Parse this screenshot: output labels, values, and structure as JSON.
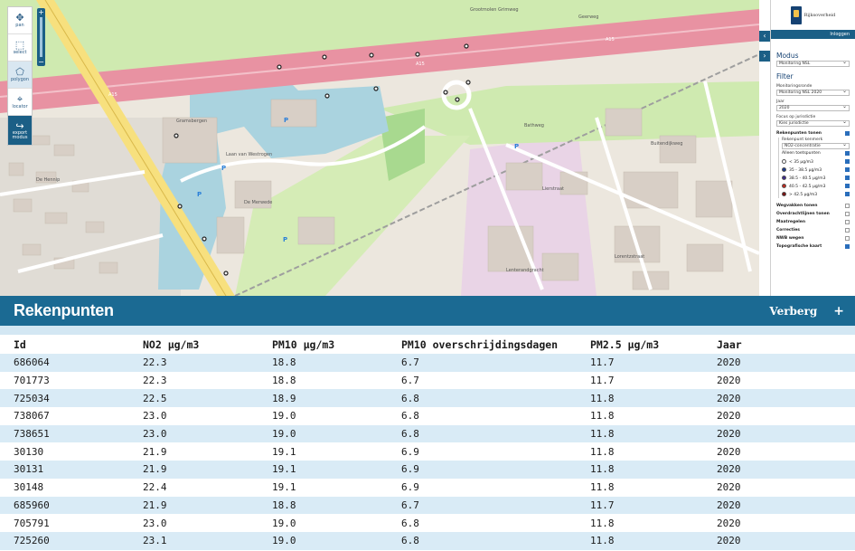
{
  "toolbar": {
    "pan": "pan",
    "select": "select",
    "polygon": "polygon",
    "locator": "locator",
    "export": "export\nmodus"
  },
  "map_labels": {
    "road_a15_1": "A15",
    "road_a15_2": "A15",
    "road_a15_3": "A15",
    "street_1": "Laan van Westrogen",
    "street_2": "De Hennip",
    "street_3": "Bathweg",
    "street_4": "Lierstraat",
    "area_1": "Lorentzstraat",
    "street_5": "Grootmolen Grimweg",
    "street_6": "Geerweg",
    "park_1": "Gramsbergen",
    "street_7": "De Merwede",
    "street_8": "Lenterandgracht",
    "street_9": "Buitendijkweg"
  },
  "panel": {
    "logo_text": "Rijksoverheid",
    "login": "Inloggen",
    "modus_title": "Modus",
    "modus_value": "Monitoring NSL",
    "filter_title": "Filter",
    "ronde_label": "Monitoringsronde",
    "ronde_value": "Monitoring NSL 2020",
    "jaar_label": "Jaar",
    "jaar_value": "2020",
    "focus_label": "Focus op jurisdictie",
    "focus_value": "Kies jurisdictie",
    "rekenpunten_toggle": "Rekenpunten tonen",
    "kenmerk_label": "Rekenpunt kenmerk",
    "kenmerk_value": "NO2-concentratie",
    "alleen": "Alleen toetspunten",
    "legend": [
      {
        "label": "< 35 µg/m3",
        "color": "#ffffff"
      },
      {
        "label": "35 - 38.5 µg/m3",
        "color": "#1c3b8f"
      },
      {
        "label": "38.5 - 40.5 µg/m3",
        "color": "#3c2a8a"
      },
      {
        "label": "40.5 - 42.5 µg/m3",
        "color": "#c0281e"
      },
      {
        "label": "> 42.5 µg/m3",
        "color": "#7a1010"
      }
    ],
    "layers": [
      {
        "label": "Wegvakken tonen",
        "on": false
      },
      {
        "label": "Overdrachtlijnen tonen",
        "on": false
      },
      {
        "label": "Maatregelen",
        "on": false
      },
      {
        "label": "Correcties",
        "on": false
      },
      {
        "label": "NWB wegen",
        "on": false
      },
      {
        "label": "Topografische kaart",
        "on": true
      }
    ]
  },
  "section": {
    "title": "Rekenpunten",
    "hide_button": "Verberg",
    "plus_button": "+"
  },
  "table": {
    "headers": [
      "Id",
      "NO2 µg/m3",
      "PM10 µg/m3",
      "PM10 overschrijdingsdagen",
      "PM2.5 µg/m3",
      "Jaar"
    ],
    "rows": [
      [
        "686064",
        "22.3",
        "18.8",
        "6.7",
        "11.7",
        "2020"
      ],
      [
        "701773",
        "22.3",
        "18.8",
        "6.7",
        "11.7",
        "2020"
      ],
      [
        "725034",
        "22.5",
        "18.9",
        "6.8",
        "11.8",
        "2020"
      ],
      [
        "738067",
        "23.0",
        "19.0",
        "6.8",
        "11.8",
        "2020"
      ],
      [
        "738651",
        "23.0",
        "19.0",
        "6.8",
        "11.8",
        "2020"
      ],
      [
        "30130",
        "21.9",
        "19.1",
        "6.9",
        "11.8",
        "2020"
      ],
      [
        "30131",
        "21.9",
        "19.1",
        "6.9",
        "11.8",
        "2020"
      ],
      [
        "30148",
        "22.4",
        "19.1",
        "6.9",
        "11.8",
        "2020"
      ],
      [
        "685960",
        "21.9",
        "18.8",
        "6.7",
        "11.7",
        "2020"
      ],
      [
        "705791",
        "23.0",
        "19.0",
        "6.8",
        "11.8",
        "2020"
      ],
      [
        "725260",
        "23.1",
        "19.0",
        "6.8",
        "11.8",
        "2020"
      ]
    ]
  }
}
